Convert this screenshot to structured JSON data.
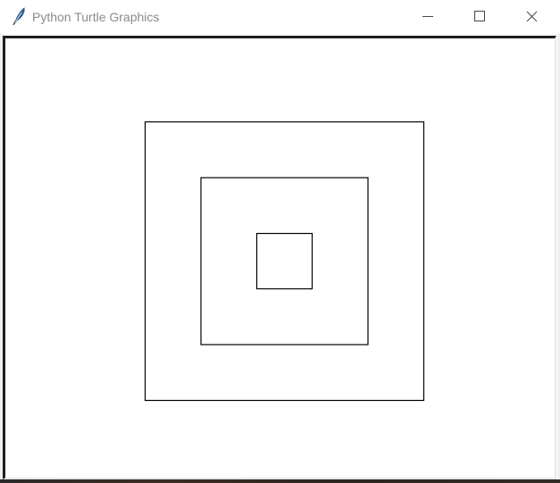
{
  "window": {
    "title": "Python Turtle Graphics",
    "icon": "feather-icon",
    "controls": {
      "minimize": "minimize-icon",
      "maximize": "maximize-icon",
      "close": "close-icon"
    }
  },
  "canvas": {
    "background": "#ffffff",
    "pen_color": "#000000",
    "shapes": [
      {
        "type": "square",
        "side": 312
      },
      {
        "type": "square",
        "side": 187
      },
      {
        "type": "square",
        "side": 62
      }
    ]
  }
}
